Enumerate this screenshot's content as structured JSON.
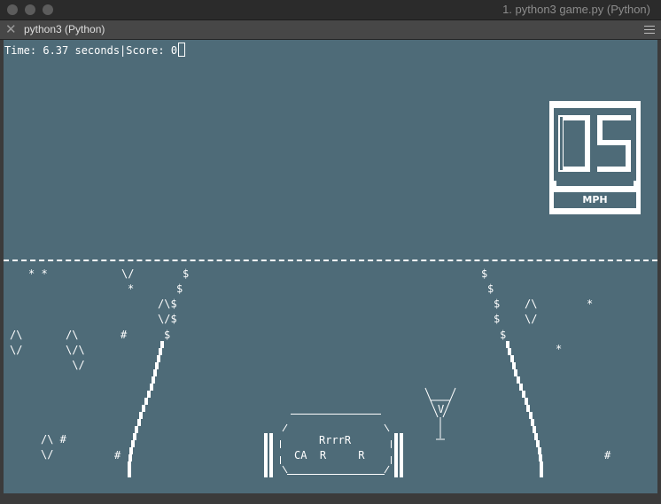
{
  "window": {
    "title": "1. python3 game.py (Python)",
    "tab_label": "python3 (Python)",
    "close_glyph": "✕"
  },
  "hud": {
    "status_text": "Time: 6.37 seconds|Score: 0",
    "time_seconds": 6.37,
    "score": 0
  },
  "speedometer": {
    "value": "05",
    "unit": "MPH"
  },
  "scenery": {
    "left_top_stars": "* *",
    "left_chevron_1": "\\/",
    "left_star_2": "*",
    "left_hash_1": "#",
    "left_arrow_a": "/\\\n\\/",
    "left_arrow_b": "/\\\n\\/\\\n \\/",
    "left_bottom_1": "/\\ #\n\\/",
    "left_bottom_hash": "#",
    "right_arrow": "/\\\n\\/",
    "right_star_1": "*",
    "right_star_2": "*",
    "right_hash": "#"
  },
  "road": {
    "left_signs": [
      "$",
      "$",
      "/\\$",
      "\\/$",
      "$"
    ],
    "right_signs": [
      "$",
      "$",
      "$",
      "$",
      "$"
    ]
  },
  "car": {
    "top_line": "________________",
    "slants_top": "/              \\",
    "engine_line": "RrrrR",
    "body_line": "CA  R     R",
    "slants_bottom": "\\______________/"
  },
  "cup": {
    "letter": "V"
  },
  "colors": {
    "terminal_bg": "#4e6b78",
    "foreground": "#ffffff",
    "titlebar_bg": "#2b2b2b",
    "tabbar_bg": "#474747"
  }
}
